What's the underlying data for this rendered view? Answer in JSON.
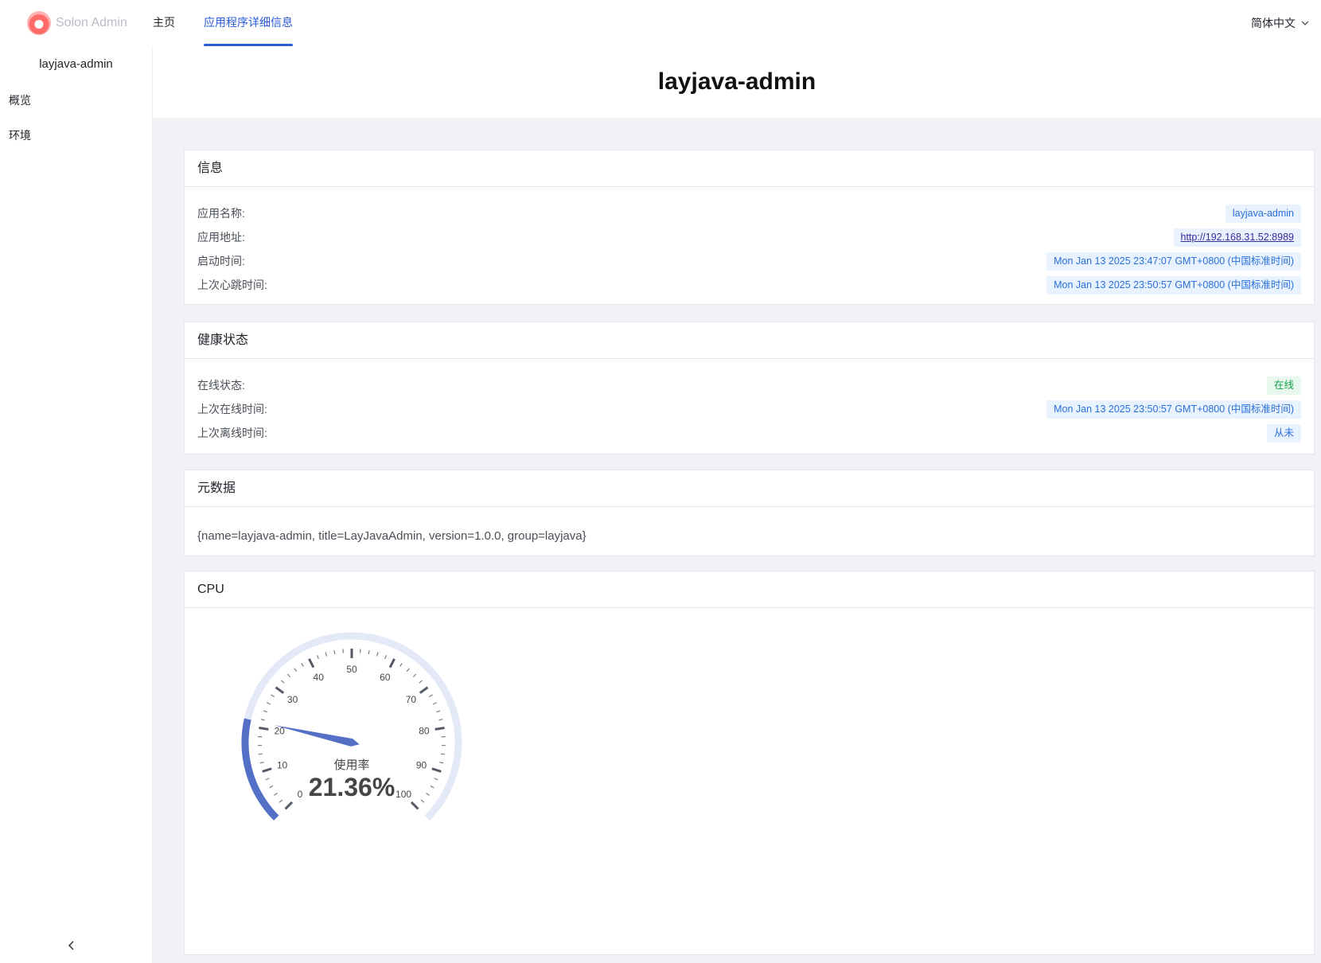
{
  "brand": {
    "name": "Solon Admin"
  },
  "nav": {
    "home": "主页",
    "details": "应用程序详细信息",
    "language": "简体中文"
  },
  "sidebar": {
    "app_name": "layjava-admin",
    "items": [
      {
        "label": "概览"
      },
      {
        "label": "环境"
      }
    ]
  },
  "page": {
    "title": "layjava-admin"
  },
  "info": {
    "title": "信息",
    "rows": [
      {
        "label": "应用名称:",
        "value": "layjava-admin"
      },
      {
        "label": "应用地址:",
        "value": "http://192.168.31.52:8989"
      },
      {
        "label": "启动时间:",
        "value": "Mon Jan 13 2025 23:47:07 GMT+0800 (中国标准时间)"
      },
      {
        "label": "上次心跳时间:",
        "value": "Mon Jan 13 2025 23:50:57 GMT+0800 (中国标准时间)"
      }
    ]
  },
  "health": {
    "title": "健康状态",
    "rows": [
      {
        "label": "在线状态:",
        "value": "在线"
      },
      {
        "label": "上次在线时间:",
        "value": "Mon Jan 13 2025 23:50:57 GMT+0800 (中国标准时间)"
      },
      {
        "label": "上次离线时间:",
        "value": "从未"
      }
    ]
  },
  "metadata": {
    "title": "元数据",
    "text": "{name=layjava-admin, title=LayJavaAdmin, version=1.0.0, group=layjava}"
  },
  "cpu": {
    "title": "CPU",
    "gauge": {
      "label": "使用率",
      "value_text": "21.36%",
      "value": 21.36,
      "min": 0,
      "max": 100,
      "ticks": [
        "0",
        "10",
        "20",
        "30",
        "40",
        "50",
        "60",
        "70",
        "80",
        "90",
        "100"
      ],
      "accent_color": "#5470c6",
      "track_color": "#e3e9f7"
    }
  }
}
